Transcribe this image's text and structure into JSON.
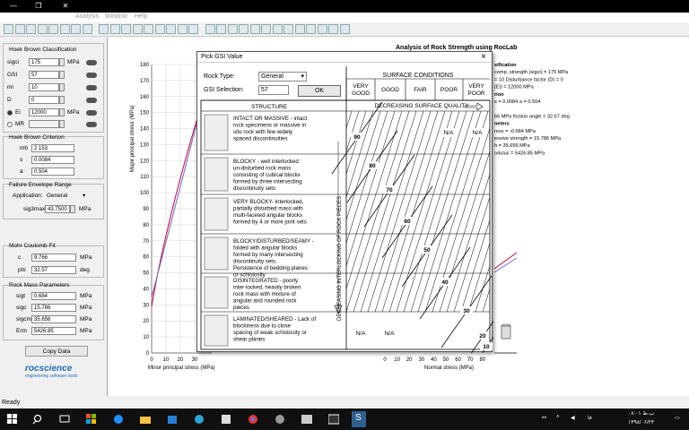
{
  "window": {
    "min": "—",
    "max": "❐",
    "close": "✕"
  },
  "menu": {
    "items": [
      "Analysis",
      "Window",
      "Help"
    ]
  },
  "hoek_brown_classification": {
    "title": "Hoek Brown Classification",
    "rows": [
      {
        "label": "sigci",
        "value": "175",
        "unit": "MPa"
      },
      {
        "label": "GSI",
        "value": "57",
        "unit": ""
      },
      {
        "label": "mi",
        "value": "10",
        "unit": ""
      },
      {
        "label": "D",
        "value": "0",
        "unit": ""
      },
      {
        "label": "Ei",
        "value": "12000",
        "unit": "MPa"
      },
      {
        "label": "MR",
        "value": "",
        "unit": ""
      }
    ]
  },
  "hoek_brown_criterion": {
    "title": "Hoek Brown Criterion",
    "rows": [
      {
        "label": "mb",
        "value": "2.153"
      },
      {
        "label": "s",
        "value": "0.0084"
      },
      {
        "label": "a",
        "value": "0.504"
      }
    ]
  },
  "failure_envelope": {
    "title": "Failure Envelope Range",
    "application_label": "Application:",
    "application_value": "General",
    "sig3max_label": "sig3max",
    "sig3max_value": "43.7500",
    "sig3max_unit": "MPa"
  },
  "mohr_coulomb": {
    "title": "Mohr Coulomb Fit",
    "rows": [
      {
        "label": "c",
        "value": "9.766",
        "unit": "MPa"
      },
      {
        "label": "phi",
        "value": "32.57",
        "unit": "deg"
      }
    ]
  },
  "rock_mass": {
    "title": "Rock Mass Parameters",
    "rows": [
      {
        "label": "sigt",
        "value": "0.684",
        "unit": "MPa"
      },
      {
        "label": "sigc",
        "value": "15.786",
        "unit": "MPa"
      },
      {
        "label": "sigcm",
        "value": "35.656",
        "unit": "MPa"
      },
      {
        "label": "Erm",
        "value": "5426.85",
        "unit": "MPa"
      }
    ]
  },
  "copy_data_label": "Copy Data",
  "logo_text": "rocscience",
  "logo_sub": "engineering software tools",
  "chart": {
    "title": "Analysis of Rock Strength using RocLab",
    "ylabel": "Major principal stress (MPa)",
    "xlabel_left": "Minor principal stress (MPa)",
    "xlabel_right": "Normal stress (MPa)",
    "yticks": [
      "180",
      "170",
      "160",
      "150",
      "140",
      "130",
      "120",
      "110",
      "100",
      "90",
      "80",
      "70",
      "60",
      "50",
      "40",
      "30",
      "20",
      "10",
      "0"
    ],
    "xticks_left": [
      "0",
      "10",
      "20",
      "30"
    ],
    "xticks_right": [
      "0",
      "10",
      "20",
      "30",
      "40",
      "50",
      "60",
      "70",
      "80"
    ],
    "info_lines": [
      "sification",
      "comp. strength (sigci) = 175 MPa",
      "= 10  Disturbance factor (D) = 0",
      "(Ei) = 12000 MPa",
      "rion",
      "s = 0.0084   a = 0.504",
      "",
      "66 MPa   friction angle = 32.57 deg",
      "neters",
      "ress = -0.684 MPa",
      "essive strength = 15.786 MPa",
      "h = 35.656 MPa",
      "odulus = 5426.85 MPa"
    ]
  },
  "gsi_dialog": {
    "title": "Pick GSI Value",
    "rock_type_label": "Rock Type:",
    "rock_type_value": "General",
    "gsi_label": "GSI Selection:",
    "gsi_value": "57",
    "ok_label": "OK",
    "surface_header": "SURFACE CONDITIONS",
    "surface_cols": [
      "VERY GOOD",
      "GOOD",
      "FAIR",
      "POOR",
      "VERY POOR"
    ],
    "decreasing_quality": "DECREASING SURFACE QUALITY",
    "structure_header": "STRUCTURE",
    "interlocking_label": "DECREASING INTERLOCKING OF ROCK PIECES",
    "structures": [
      {
        "bold": "INTACT OR MASSIVE",
        "text": " - intact rock specimens or massive in situ rock with few widely spaced discontinuities"
      },
      {
        "bold": "BLOCKY",
        "text": " - well interlocked un-disturbed rock mass consisting of cubical blocks formed by three intersecting discontinuity sets"
      },
      {
        "bold": "VERY BLOCKY",
        "text": "- interlocked, partially disturbed mass with multi-faceted angular blocks formed by 4 or more joint sets"
      },
      {
        "bold": "BLOCKY/DISTURBED/SEAMY",
        "text": " - folded with angular blocks formed by many intersecting discontinuity sets. Persistence of bedding planes or schistosity"
      },
      {
        "bold": "DISINTEGRATED",
        "text": " - poorly inter-locked, heavily broken rock mass with mixture of angular and rounded rock pieces"
      },
      {
        "bold": "LAMINATED/SHEARED",
        "text": " - Lack of blockiness due to close spacing of weak schistosity or shear planes"
      }
    ],
    "gsi_lines": [
      "90",
      "80",
      "70",
      "60",
      "50",
      "40",
      "30",
      "20",
      "10"
    ],
    "na": "N/A"
  },
  "status": "Ready",
  "taskbar": {
    "clock_time": "ب.ظ ۰۸:۰۱",
    "clock_date": "۱۳۹۸/۰۶/۲۴",
    "lang": "فا"
  }
}
